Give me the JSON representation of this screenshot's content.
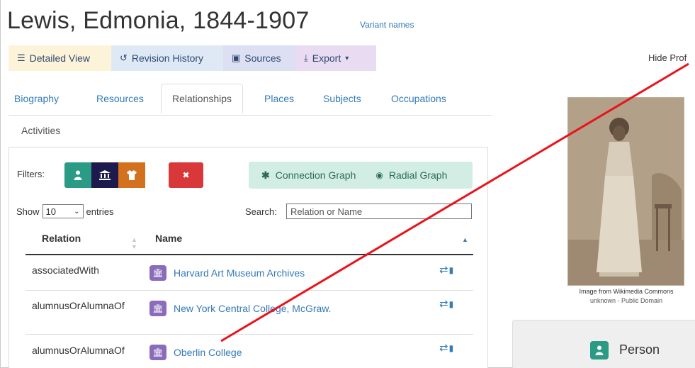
{
  "page": {
    "title": "Lewis, Edmonia, 1844-1907",
    "variant_link": "Variant names",
    "hide_profile": "Hide Prof"
  },
  "toolbar": {
    "detailed_view": "Detailed View",
    "revision_history": "Revision History",
    "sources": "Sources",
    "export": "Export",
    "export_caret": "▾"
  },
  "tabs": {
    "biography": "Biography",
    "resources": "Resources",
    "relationships": "Relationships",
    "places": "Places",
    "subjects": "Subjects",
    "occupations": "Occupations",
    "activities": "Activities"
  },
  "filters": {
    "label": "Filters:",
    "clear_symbol": "✖"
  },
  "graphs": {
    "connection": "Connection Graph",
    "radial": "Radial Graph"
  },
  "table_controls": {
    "show": "Show",
    "entries_value": "10",
    "entries": "entries",
    "search_label": "Search:",
    "search_placeholder": "Relation or Name"
  },
  "table": {
    "col_relation": "Relation",
    "col_name": "Name",
    "rows": [
      {
        "relation": "associatedWith",
        "name": "Harvard Art Museum Archives"
      },
      {
        "relation": "alumnusOrAlumnaOf",
        "name": "New York Central College, McGraw."
      },
      {
        "relation": "alumnusOrAlumnaOf",
        "name": "Oberlin College"
      }
    ],
    "row_action_glyph": "⇄"
  },
  "image": {
    "caption_source": "Image from Wikimedia Commons",
    "caption_license": "unknown - Public Domain"
  },
  "entity_type": {
    "label": "Person"
  },
  "colors": {
    "link": "#337ab7",
    "filter_person": "#2b9b85",
    "filter_corporate": "#1d1a4e",
    "filter_family": "#d4711f",
    "filter_clear": "#d9383a",
    "annotation_line": "#e8141b"
  }
}
